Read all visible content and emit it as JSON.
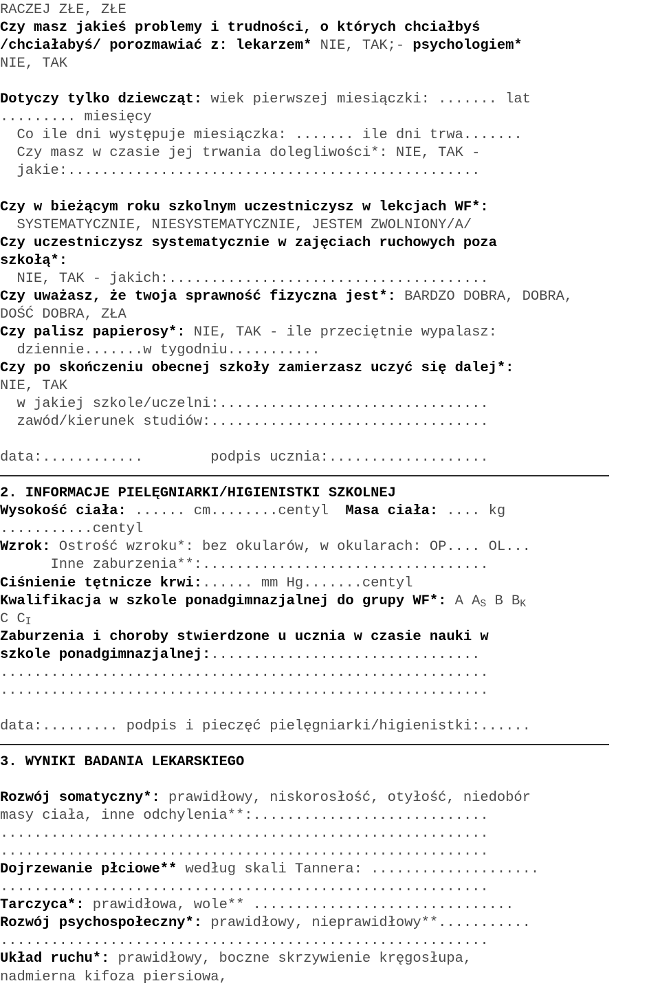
{
  "document": {
    "kind": "polish-school-health-examination-form",
    "font_is_monospace": true,
    "rule_color": "#2b2b2b"
  },
  "lines": [
    {
      "id": "l01",
      "segments": [
        {
          "text": "RACZEJ ZŁE, ZŁE",
          "bold": false
        }
      ]
    },
    {
      "id": "l02",
      "segments": [
        {
          "text": "Czy masz jakieś problemy i trudności, o których chciałbyś",
          "bold": true
        }
      ]
    },
    {
      "id": "l03",
      "segments": [
        {
          "text": "/chciałabyś/ porozmawiać z: lekarzem*",
          "bold": true
        },
        {
          "text": " NIE, TAK;- ",
          "bold": false
        },
        {
          "text": "psychologiem*",
          "bold": true
        }
      ]
    },
    {
      "id": "l04",
      "segments": [
        {
          "text": "NIE, TAK",
          "bold": false
        }
      ]
    },
    {
      "id": "l05",
      "blank": true,
      "segments": [
        {
          "text": " ",
          "bold": false
        }
      ]
    },
    {
      "id": "l06",
      "segments": [
        {
          "text": "Dotyczy tylko dziewcząt:",
          "bold": true
        },
        {
          "text": " wiek pierwszej miesiączki: ....... lat",
          "bold": false
        }
      ]
    },
    {
      "id": "l07",
      "segments": [
        {
          "text": "......... miesięcy",
          "bold": false
        }
      ]
    },
    {
      "id": "l08",
      "segments": [
        {
          "text": "  Co ile dni występuje miesiączka: ....... ile dni trwa.......",
          "bold": false
        }
      ]
    },
    {
      "id": "l09",
      "segments": [
        {
          "text": "  Czy masz w czasie jej trwania dolegliwości*: NIE, TAK -",
          "bold": false
        }
      ]
    },
    {
      "id": "l10",
      "segments": [
        {
          "text": "  jakie:.................................................",
          "bold": false
        }
      ]
    },
    {
      "id": "l11",
      "blank": true,
      "segments": [
        {
          "text": " ",
          "bold": false
        }
      ]
    },
    {
      "id": "l12",
      "segments": [
        {
          "text": "Czy w bieżącym roku szkolnym uczestniczysz w lekcjach WF*:",
          "bold": true
        }
      ]
    },
    {
      "id": "l13",
      "segments": [
        {
          "text": "  SYSTEMATYCZNIE, NIESYSTEMATYCZNIE, JESTEM ZWOLNIONY/A/",
          "bold": false
        }
      ]
    },
    {
      "id": "l14",
      "segments": [
        {
          "text": "Czy uczestniczysz systematycznie w zajęciach ruchowych poza",
          "bold": true
        }
      ]
    },
    {
      "id": "l15",
      "segments": [
        {
          "text": "szkołą*:",
          "bold": true
        }
      ]
    },
    {
      "id": "l16",
      "segments": [
        {
          "text": "  NIE, TAK - jakich:......................................",
          "bold": false
        }
      ]
    },
    {
      "id": "l17",
      "segments": [
        {
          "text": "Czy uważasz, że twoja sprawność fizyczna jest*:",
          "bold": true
        },
        {
          "text": " BARDZO DOBRA, DOBRA,",
          "bold": false
        }
      ]
    },
    {
      "id": "l18",
      "segments": [
        {
          "text": "DOŚĆ DOBRA, ZŁA",
          "bold": false
        }
      ]
    },
    {
      "id": "l19",
      "segments": [
        {
          "text": "Czy palisz papierosy*:",
          "bold": true
        },
        {
          "text": " NIE, TAK - ile przeciętnie wypalasz:",
          "bold": false
        }
      ]
    },
    {
      "id": "l20",
      "segments": [
        {
          "text": "  dziennie.......w tygodniu...........",
          "bold": false
        }
      ]
    },
    {
      "id": "l21",
      "segments": [
        {
          "text": "Czy po skończeniu obecnej szkoły zamierzasz uczyć się dalej*:",
          "bold": true
        }
      ]
    },
    {
      "id": "l22",
      "segments": [
        {
          "text": "NIE, TAK",
          "bold": false
        }
      ]
    },
    {
      "id": "l23",
      "segments": [
        {
          "text": "  w jakiej szkole/uczelni:................................",
          "bold": false
        }
      ]
    },
    {
      "id": "l24",
      "segments": [
        {
          "text": "  zawód/kierunek studiów:.................................",
          "bold": false
        }
      ]
    },
    {
      "id": "l25",
      "blank": true,
      "segments": [
        {
          "text": " ",
          "bold": false
        }
      ]
    },
    {
      "id": "l26",
      "segments": [
        {
          "text": "data:............        podpis ucznia:...................",
          "bold": false
        }
      ]
    },
    {
      "id": "l27",
      "rule": true
    },
    {
      "id": "l28",
      "segments": [
        {
          "text": "2. INFORMACJE PIELĘGNIARKI/HIGIENISTKI SZKOLNEJ",
          "bold": true
        }
      ]
    },
    {
      "id": "l29",
      "segments": [
        {
          "text": "Wysokość ciała:",
          "bold": true
        },
        {
          "text": " ...... cm........centyl  ",
          "bold": false
        },
        {
          "text": "Masa ciała:",
          "bold": true
        },
        {
          "text": " .... kg",
          "bold": false
        }
      ]
    },
    {
      "id": "l30",
      "segments": [
        {
          "text": "...........centyl",
          "bold": false
        }
      ]
    },
    {
      "id": "l31",
      "segments": [
        {
          "text": "Wzrok:",
          "bold": true
        },
        {
          "text": " Ostrość wzroku*: bez okularów, w okularach: OP.... OL...",
          "bold": false
        }
      ]
    },
    {
      "id": "l32",
      "segments": [
        {
          "text": "      Inne zaburzenia**:..................................",
          "bold": false
        }
      ]
    },
    {
      "id": "l33",
      "segments": [
        {
          "text": "Ciśnienie tętnicze krwi:",
          "bold": true
        },
        {
          "text": "...... mm Hg.......centyl",
          "bold": false
        }
      ]
    },
    {
      "id": "l34",
      "segments": [
        {
          "text": "Kwalifikacja w szkole ponadgimnazjalnej do grupy WF*:",
          "bold": true
        },
        {
          "text": " A A",
          "bold": false
        },
        {
          "text": "S",
          "bold": false,
          "sub": true
        },
        {
          "text": " B B",
          "bold": false
        },
        {
          "text": "K",
          "bold": false,
          "sub": true
        }
      ]
    },
    {
      "id": "l35",
      "segments": [
        {
          "text": "C C",
          "bold": false
        },
        {
          "text": "I",
          "bold": false,
          "sub": true
        }
      ]
    },
    {
      "id": "l36",
      "segments": [
        {
          "text": "Zaburzenia i choroby stwierdzone u ucznia w czasie nauki w",
          "bold": true
        }
      ]
    },
    {
      "id": "l37",
      "segments": [
        {
          "text": "szkole ponadgimnazjalnej:",
          "bold": true
        },
        {
          "text": "................................",
          "bold": false
        }
      ]
    },
    {
      "id": "l38",
      "segments": [
        {
          "text": "..........................................................",
          "bold": false
        }
      ]
    },
    {
      "id": "l39",
      "segments": [
        {
          "text": "..........................................................",
          "bold": false
        }
      ]
    },
    {
      "id": "l40",
      "blank": true,
      "segments": [
        {
          "text": " ",
          "bold": false
        }
      ]
    },
    {
      "id": "l41",
      "segments": [
        {
          "text": "data:......... podpis i pieczęć pielęgniarki/higienistki:......",
          "bold": false
        }
      ]
    },
    {
      "id": "l42",
      "rule": true
    },
    {
      "id": "l43",
      "segments": [
        {
          "text": "3. WYNIKI BADANIA LEKARSKIEGO",
          "bold": true
        }
      ]
    },
    {
      "id": "l44",
      "blank": true,
      "segments": [
        {
          "text": " ",
          "bold": false
        }
      ]
    },
    {
      "id": "l45",
      "segments": [
        {
          "text": "Rozwój somatyczny*:",
          "bold": true
        },
        {
          "text": " prawidłowy, niskorosłość, otyłość, niedobór",
          "bold": false
        }
      ]
    },
    {
      "id": "l46",
      "segments": [
        {
          "text": "masy ciała, inne odchylenia**:............................",
          "bold": false
        }
      ]
    },
    {
      "id": "l47",
      "segments": [
        {
          "text": "..........................................................",
          "bold": false
        }
      ]
    },
    {
      "id": "l48",
      "segments": [
        {
          "text": "..........................................................",
          "bold": false
        }
      ]
    },
    {
      "id": "l49",
      "segments": [
        {
          "text": "Dojrzewanie płciowe**",
          "bold": true
        },
        {
          "text": " według skali Tannera: ....................",
          "bold": false
        }
      ]
    },
    {
      "id": "l50",
      "segments": [
        {
          "text": "..........................................................",
          "bold": false
        }
      ]
    },
    {
      "id": "l51",
      "segments": [
        {
          "text": "Tarczyca*:",
          "bold": true
        },
        {
          "text": " prawidłowa, wole** ...............................",
          "bold": false
        }
      ]
    },
    {
      "id": "l52",
      "segments": [
        {
          "text": "Rozwój psychospołeczny*:",
          "bold": true
        },
        {
          "text": " prawidłowy, nieprawidłowy**...........",
          "bold": false
        }
      ]
    },
    {
      "id": "l53",
      "segments": [
        {
          "text": "..........................................................",
          "bold": false
        }
      ]
    },
    {
      "id": "l54",
      "segments": [
        {
          "text": "Układ ruchu*:",
          "bold": true
        },
        {
          "text": " prawidłowy, boczne skrzywienie kręgosłupa,",
          "bold": false
        }
      ]
    },
    {
      "id": "l55",
      "segments": [
        {
          "text": "nadmierna kifoza piersiowa,",
          "bold": false
        }
      ]
    }
  ]
}
